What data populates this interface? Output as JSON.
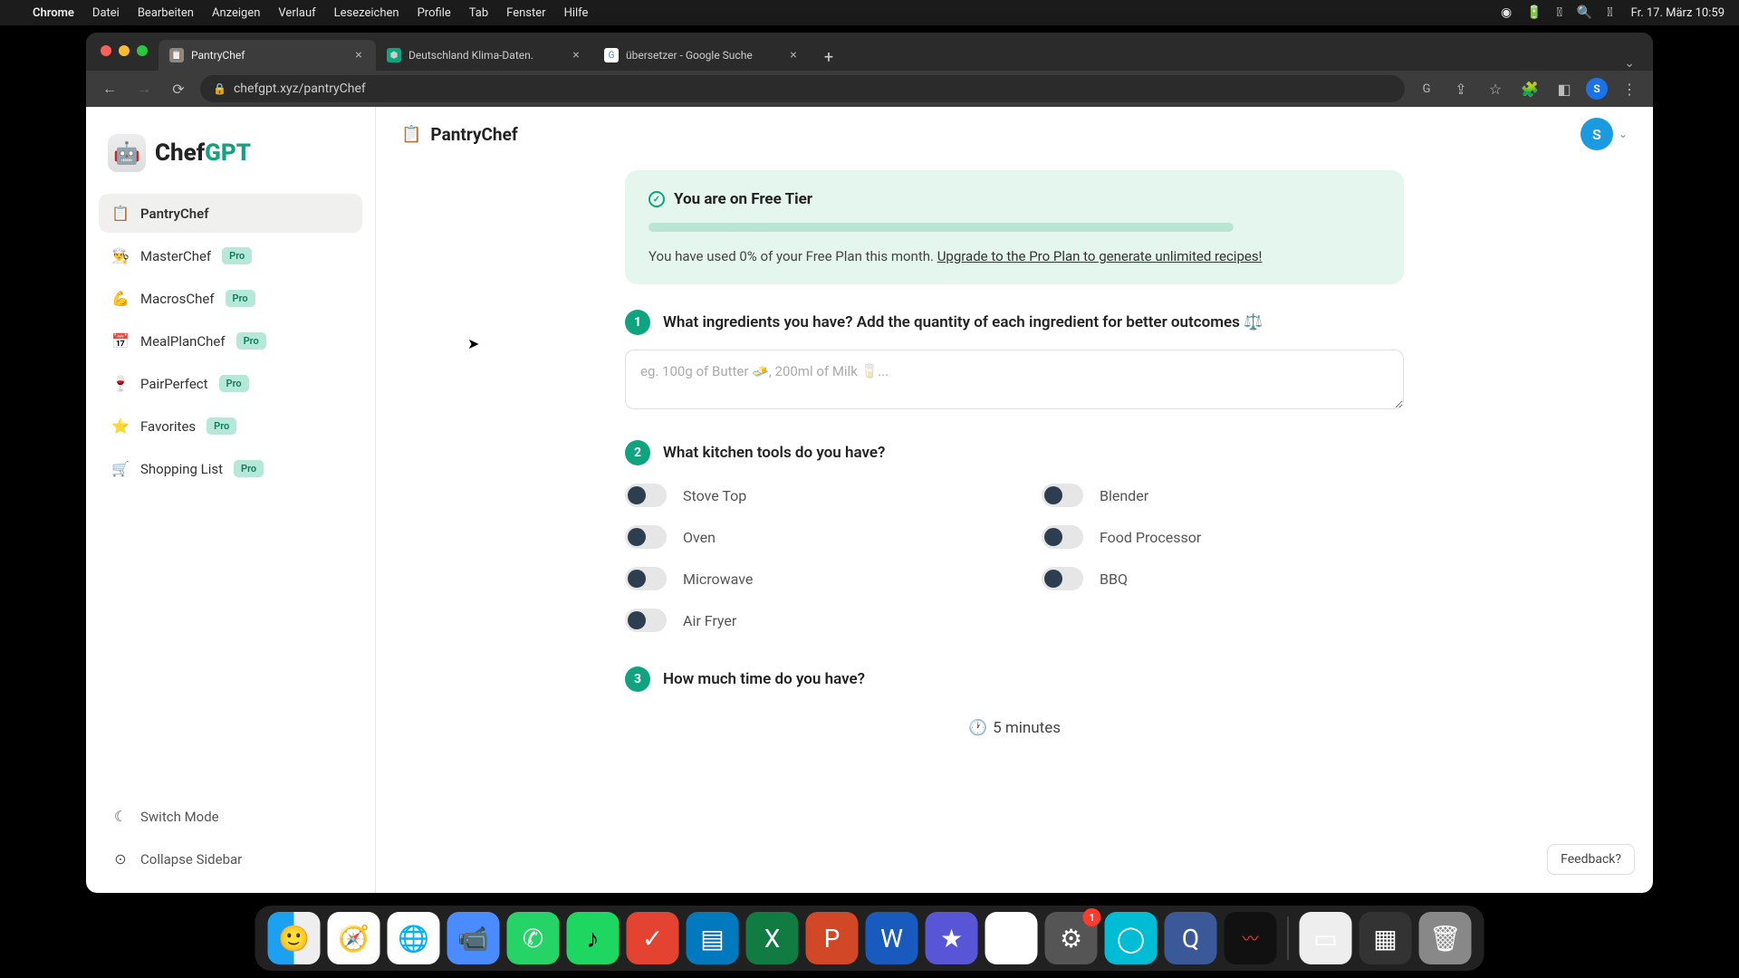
{
  "menubar": {
    "app": "Chrome",
    "items": [
      "Datei",
      "Bearbeiten",
      "Anzeigen",
      "Verlauf",
      "Lesezeichen",
      "Profile",
      "Tab",
      "Fenster",
      "Hilfe"
    ],
    "clock": "Fr. 17. März  10:59"
  },
  "tabs": {
    "t0": "PantryChef",
    "t1": "Deutschland Klima-Daten.",
    "t2": "übersetzer - Google Suche"
  },
  "address": "chefgpt.xyz/pantryChef",
  "logo": {
    "chef": "Chef",
    "gpt": "GPT"
  },
  "sidebar": {
    "items": {
      "pantrychef": {
        "emoji": "📋",
        "label": "PantryChef"
      },
      "masterchef": {
        "emoji": "👨‍🍳",
        "label": "MasterChef",
        "badge": "Pro"
      },
      "macroschef": {
        "emoji": "💪",
        "label": "MacrosChef",
        "badge": "Pro"
      },
      "mealplanchef": {
        "emoji": "📅",
        "label": "MealPlanChef",
        "badge": "Pro"
      },
      "pairperfect": {
        "emoji": "🍷",
        "label": "PairPerfect",
        "badge": "Pro"
      },
      "favorites": {
        "emoji": "⭐",
        "label": "Favorites",
        "badge": "Pro"
      },
      "shoppinglist": {
        "emoji": "🛒",
        "label": "Shopping List",
        "badge": "Pro"
      }
    },
    "switch_mode": "Switch Mode",
    "collapse": "Collapse Sidebar"
  },
  "header": {
    "title": "PantryChef",
    "avatar_initial": "S"
  },
  "banner": {
    "title": "You are on Free Tier",
    "text_prefix": "You have used 0% of your Free Plan this month. ",
    "link": "Upgrade to the Pro Plan to generate unlimited recipes!"
  },
  "steps": {
    "s1": {
      "num": "1",
      "label": "What ingredients you have? Add the quantity of each ingredient for better outcomes ⚖️"
    },
    "s2": {
      "num": "2",
      "label": "What kitchen tools do you have?"
    },
    "s3": {
      "num": "3",
      "label": "How much time do you have?"
    }
  },
  "ingredients_placeholder": "eg. 100g of Butter 🧈, 200ml of Milk 🥛...",
  "tools": {
    "stovetop": "Stove Top",
    "oven": "Oven",
    "microwave": "Microwave",
    "airfryer": "Air Fryer",
    "blender": "Blender",
    "foodprocessor": "Food Processor",
    "bbq": "BBQ"
  },
  "time_value": "5 minutes",
  "feedback": "Feedback?",
  "dock_badge": "1"
}
